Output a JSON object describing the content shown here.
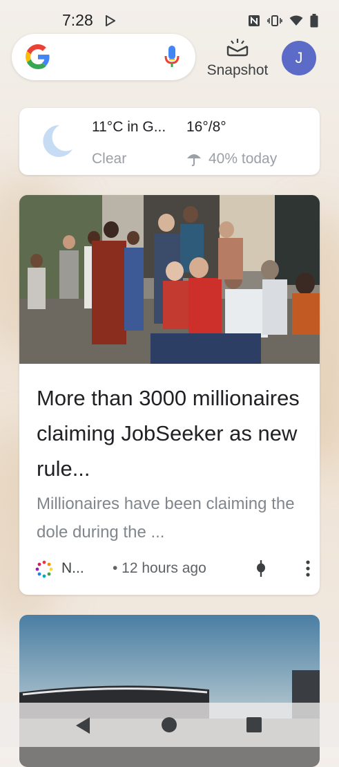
{
  "status_bar": {
    "time": "7:28"
  },
  "search": {
    "google_logo": "google-g-logo",
    "mic": "mic-icon"
  },
  "snapshot": {
    "label": "Snapshot"
  },
  "avatar": {
    "initial": "J",
    "color": "#5b6bc7"
  },
  "weather": {
    "temp_location": "11°C in G...",
    "high_low": "16°/8°",
    "condition": "Clear",
    "precipitation": "40% today"
  },
  "news_card": {
    "headline": "More than 3000 millionaires claiming JobSeeker as new rule...",
    "snippet": "Millionaires have been claiming the dole during the ...",
    "source": "N...",
    "time_ago": "• 12 hours ago"
  },
  "colors": {
    "accent": "#4285f4",
    "avatar": "#5b6bc7"
  }
}
